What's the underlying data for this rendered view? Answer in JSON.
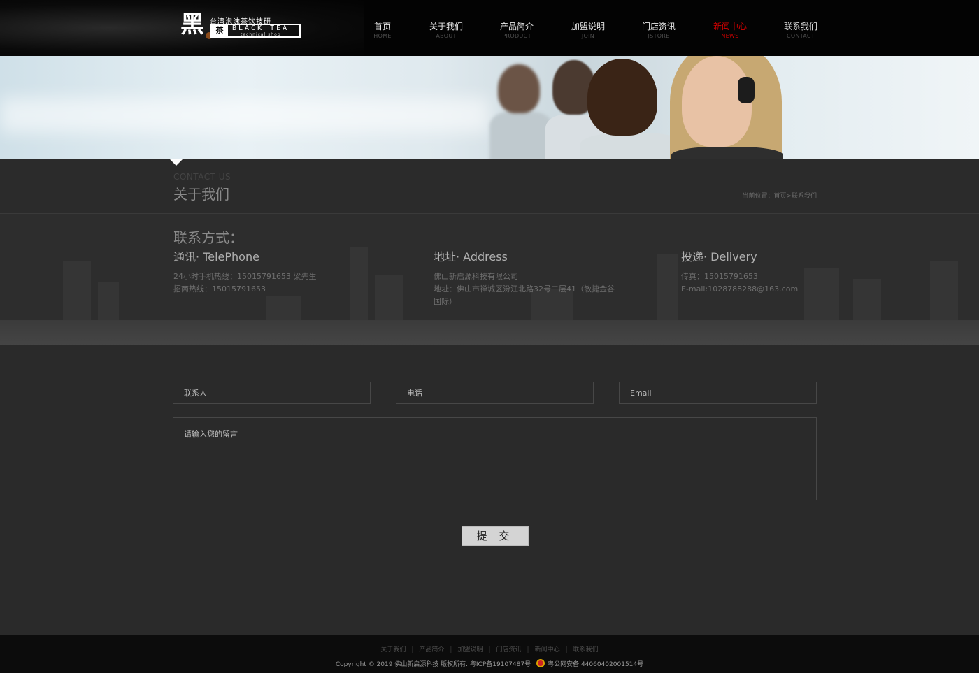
{
  "logo": {
    "char": "黑",
    "tagline": "台湾泡沫茶饮技研",
    "box_char": "茶",
    "en": "BLACK TEA",
    "sub": "technical shop"
  },
  "nav": [
    {
      "cn": "首页",
      "en": "HOME"
    },
    {
      "cn": "关于我们",
      "en": "ABOUT"
    },
    {
      "cn": "产品简介",
      "en": "PRODUCT"
    },
    {
      "cn": "加盟说明",
      "en": "JOIN"
    },
    {
      "cn": "门店资讯",
      "en": "JSTORE"
    },
    {
      "cn": "新闻中心",
      "en": "NEWS",
      "active": true
    },
    {
      "cn": "联系我们",
      "en": "CONTACT"
    }
  ],
  "page": {
    "title_en": "CONTACT US",
    "title_cn": "关于我们",
    "breadcrumb": "当前位置：首页>联系我们"
  },
  "contact": {
    "heading": "联系方式：",
    "telephone": {
      "title": "通讯· TelePhone",
      "lines": [
        "24小时手机热线：15015791653 梁先生",
        "招商热线：15015791653"
      ]
    },
    "address": {
      "title": "地址· Address",
      "lines": [
        "佛山新启源科技有限公司",
        "地址：佛山市禅城区汾江北路32号二层41（敏捷金谷",
        "国际）"
      ]
    },
    "delivery": {
      "title": "投递· Delivery",
      "lines": [
        "传真：15015791653",
        "E-mail:1028788288@163.com"
      ]
    }
  },
  "form": {
    "name_placeholder": "联系人",
    "phone_placeholder": "电话",
    "email_placeholder": "Email",
    "message_placeholder": "请输入您的留言",
    "submit_label": "提 交"
  },
  "footer": {
    "links": [
      "关于我们",
      "产品简介",
      "加盟说明",
      "门店资讯",
      "新闻中心",
      "联系我们"
    ],
    "separator": "|",
    "copyright": "Copyright © 2019 佛山新启源科技 版权所有. 粤ICP备19107487号",
    "police": "粤公网安备 44060402001514号"
  },
  "colors": {
    "accent": "#d40000",
    "header_bg": "#030303",
    "body_bg": "#2a2a2a",
    "footer_bg": "#0c0c0c"
  }
}
